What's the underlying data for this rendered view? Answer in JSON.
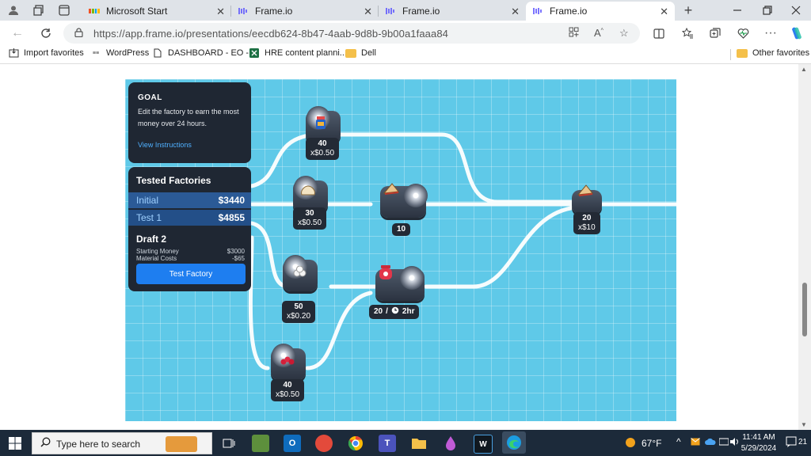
{
  "browser": {
    "tabs": [
      {
        "title": "Microsoft Start",
        "icon": "microsoft-logo-icon",
        "active": false
      },
      {
        "title": "Frame.io",
        "icon": "frameio-icon",
        "active": false
      },
      {
        "title": "Frame.io",
        "icon": "frameio-icon",
        "active": false
      },
      {
        "title": "Frame.io",
        "icon": "frameio-icon",
        "active": true
      }
    ],
    "url": "https://app.frame.io/presentations/eecdb624-8b47-4aab-9d8b-9b00a1faaa84",
    "bookmarks": [
      {
        "label": "Import favorites",
        "icon": "import-icon"
      },
      {
        "label": "WordPress",
        "icon": "wordpress-icon"
      },
      {
        "label": "DASHBOARD - EO -...",
        "icon": "page-icon"
      },
      {
        "label": "HRE content planni...",
        "icon": "excel-icon"
      },
      {
        "label": "Dell",
        "icon": "folder-icon"
      }
    ],
    "other_favorites": "Other favorites"
  },
  "game": {
    "goal": {
      "title": "GOAL",
      "text": "Edit the factory to earn the most money over 24 hours.",
      "link": "View Instructions"
    },
    "tested": {
      "title": "Tested Factories",
      "rows": [
        {
          "label": "Initial",
          "value": "$3440"
        },
        {
          "label": "Test 1",
          "value": "$4855"
        }
      ]
    },
    "draft": {
      "title": "Draft 2",
      "starting_label": "Starting Money",
      "starting_value": "$3000",
      "material_label": "Material Costs",
      "material_value": "-$65",
      "button": "Test Factory"
    },
    "nodes": {
      "jam_source": {
        "count": "40",
        "price": "x$0.50"
      },
      "bread_source": {
        "count": "30",
        "price": "x$0.50"
      },
      "sandwich_maker": {
        "count": "10"
      },
      "sugar_source": {
        "count": "50",
        "price": "x$0.20"
      },
      "jam_maker": {
        "count": "20",
        "sep": "/",
        "time": "2hr"
      },
      "berry_source": {
        "count": "40",
        "price": "x$0.50"
      },
      "output": {
        "count": "20",
        "price": "x$10"
      }
    }
  },
  "taskbar": {
    "search_placeholder": "Type here to search",
    "weather": "67°F",
    "time": "11:41 AM",
    "date": "5/29/2024",
    "notifications": "21"
  }
}
